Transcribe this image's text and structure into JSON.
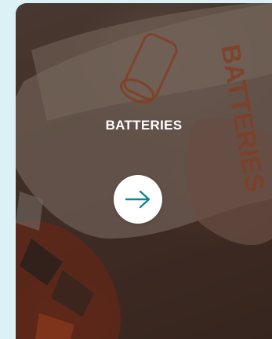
{
  "card": {
    "title": "BATTERIES",
    "background_text": "BATTERIES",
    "accent_color": "#17858e",
    "text_color": "#ffffff"
  },
  "icons": {
    "arrow": "arrow-right-icon"
  }
}
